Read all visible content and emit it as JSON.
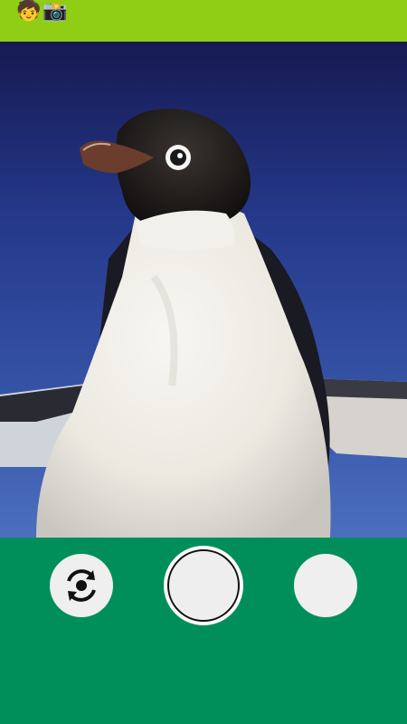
{
  "status_bar": {
    "icons": [
      "child-emoji-icon",
      "camera-with-flash-icon"
    ],
    "emoji": [
      "🧒",
      "📸"
    ],
    "color": "#8fce14"
  },
  "viewfinder": {
    "subject": "penguin-image"
  },
  "controls": {
    "background": "#008f5a",
    "switch_camera_icon": "switch-camera-icon",
    "shutter_icon": "shutter-circle",
    "gallery_icon": "gallery-thumbnail"
  }
}
